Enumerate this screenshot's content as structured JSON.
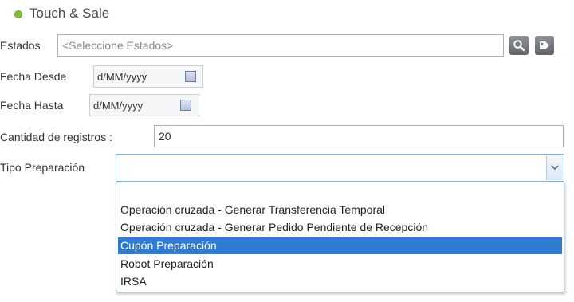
{
  "app": {
    "title": "Touch & Sale"
  },
  "form": {
    "estados": {
      "label": "Estados",
      "placeholder": "<Seleccione Estados>"
    },
    "fecha_desde": {
      "label": "Fecha Desde",
      "value": "d/MM/yyyy"
    },
    "fecha_hasta": {
      "label": "Fecha Hasta",
      "value": "d/MM/yyyy"
    },
    "cantidad": {
      "label": "Cantidad de registros :",
      "value": "20"
    },
    "tipo_preparacion": {
      "label": "Tipo Preparación",
      "value": "",
      "options": [
        "",
        "Operación cruzada - Generar Transferencia Temporal",
        "Operación cruzada - Generar Pedido Pendiente de Recepción",
        "Cupón Preparación",
        "Robot Preparación",
        "IRSA"
      ],
      "highlighted_index": 3
    }
  },
  "icons": {
    "search": "search-icon",
    "tag": "tag-icon",
    "calendar": "calendar-icon",
    "dropdown": "chevron-down-icon"
  },
  "colors": {
    "highlight": "#2e7bd1",
    "bullet": "#8bbf3a"
  }
}
